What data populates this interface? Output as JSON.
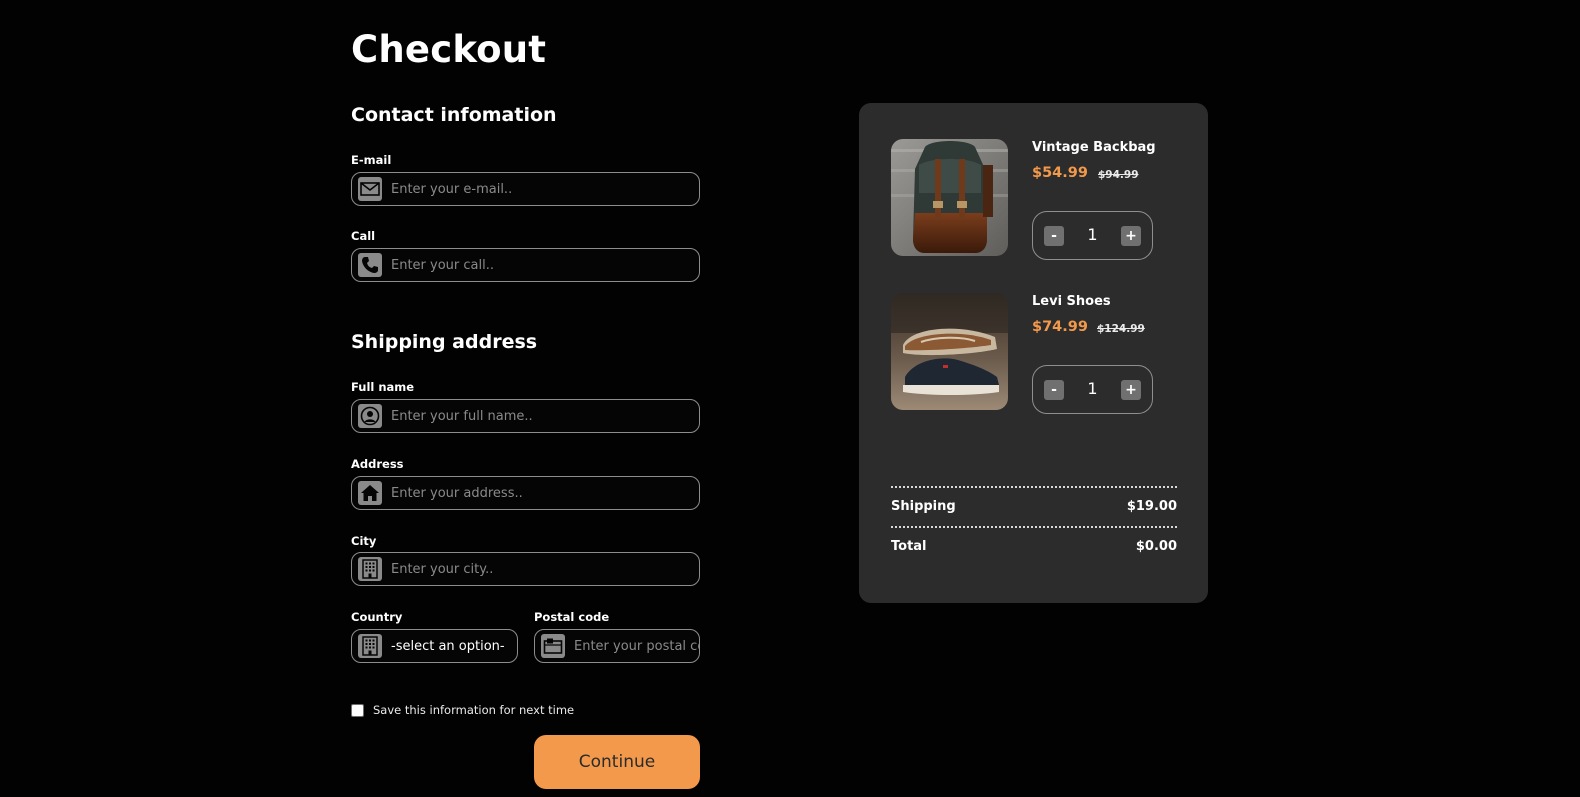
{
  "page": {
    "title": "Checkout"
  },
  "contact": {
    "heading": "Contact infomation",
    "email": {
      "label": "E-mail",
      "placeholder": "Enter your e-mail.."
    },
    "call": {
      "label": "Call",
      "placeholder": "Enter your call.."
    }
  },
  "shipping": {
    "heading": "Shipping address",
    "full_name": {
      "label": "Full name",
      "placeholder": "Enter your full name.."
    },
    "address": {
      "label": "Address",
      "placeholder": "Enter your address.."
    },
    "city": {
      "label": "City",
      "placeholder": "Enter your city.."
    },
    "country": {
      "label": "Country",
      "selected": "-select an option-"
    },
    "postal_code": {
      "label": "Postal code",
      "placeholder": "Enter your postal code.."
    }
  },
  "save_info": {
    "label": "Save this information for next time",
    "checked": false
  },
  "continue_button": {
    "label": "Continue"
  },
  "cart": {
    "items": [
      {
        "name": "Vintage Backbag",
        "price": "$54.99",
        "old_price": "$94.99",
        "quantity": "1",
        "minus": "-",
        "plus": "+",
        "image": "backpack-photo"
      },
      {
        "name": "Levi Shoes",
        "price": "$74.99",
        "old_price": "$124.99",
        "quantity": "1",
        "minus": "-",
        "plus": "+",
        "image": "shoes-photo"
      }
    ],
    "shipping": {
      "label": "Shipping",
      "value": "$19.00"
    },
    "total": {
      "label": "Total",
      "value": "$0.00"
    }
  },
  "icons": {
    "email": "envelope-icon",
    "call": "phone-icon",
    "full_name": "user-circle-icon",
    "address": "home-icon",
    "city": "building-icon",
    "country": "building-icon",
    "postal_code": "mailbox-icon"
  },
  "colors": {
    "background": "#020202",
    "card": "#2c2c2c",
    "accent": "#f3994b",
    "field_border": "#8d8d8d"
  }
}
